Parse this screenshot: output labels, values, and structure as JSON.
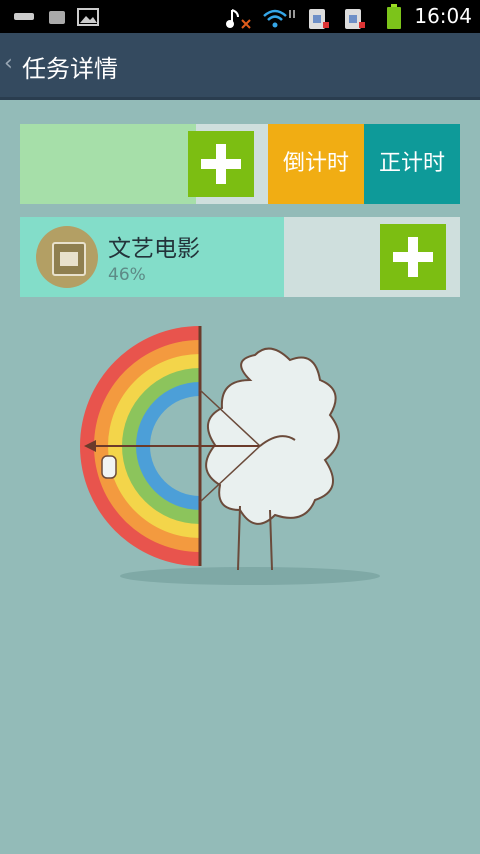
{
  "status_bar": {
    "time": "16:04"
  },
  "header": {
    "title": "任务详情"
  },
  "timer_row": {
    "countdown_label": "倒计时",
    "countup_label": "正计时",
    "progress": 0.4
  },
  "task": {
    "name": "文艺电影",
    "percent": "46%",
    "progress": 0.6
  },
  "colors": {
    "title_bar": "#344a5f",
    "background": "#93bbb8",
    "plus_green": "#7cbe12",
    "countdown_orange": "#f1ad13",
    "countup_teal": "#0e9a99"
  }
}
